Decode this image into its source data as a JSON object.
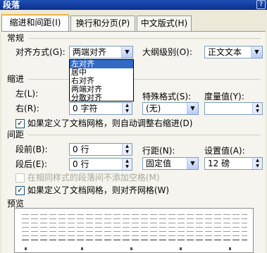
{
  "window": {
    "title": "段落",
    "help": "?"
  },
  "tabs": [
    {
      "label": "缩进和间距",
      "key": "(I)",
      "active": true
    },
    {
      "label": "换行和分页",
      "key": "(P)",
      "active": false
    },
    {
      "label": "中文版式",
      "key": "(H)",
      "active": false
    }
  ],
  "general": {
    "section_title": "常规",
    "alignment_label": "对齐方式",
    "alignment_key": "(G):",
    "alignment_value": "两端对齐",
    "alignment_options": [
      "左对齐",
      "居中",
      "右对齐",
      "两端对齐",
      "分散对齐"
    ],
    "alignment_highlighted": "左对齐",
    "outline_label": "大纲级别",
    "outline_key": "(O):",
    "outline_value": "正文文本"
  },
  "indent": {
    "section_title": "缩进",
    "left_label": "左",
    "left_key": "(L):",
    "right_label": "右",
    "right_key": "(R):",
    "right_value": "0 字符",
    "special_label": "特殊格式",
    "special_key": "(S):",
    "special_value": "(无)",
    "by_label": "度量值",
    "by_key": "(Y):",
    "by_value": "",
    "auto_adjust_label": "如果定义了文档网格，则自动调整右缩进",
    "auto_adjust_key": "(D)",
    "auto_adjust_checked": true
  },
  "spacing": {
    "section_title": "间距",
    "before_label": "段前",
    "before_key": "(B):",
    "before_value": "0 行",
    "after_label": "段后",
    "after_key": "(E):",
    "after_value": "0 行",
    "line_label": "行距",
    "line_key": "(N):",
    "line_value": "固定值",
    "at_label": "设置值",
    "at_key": "(A):",
    "at_value": "12 磅",
    "no_space_label": "在相同样式的段落间不添加空格",
    "no_space_key": "(M)",
    "no_space_checked": false,
    "snap_grid_label": "如果定义了文档网格，则对齐网格",
    "snap_grid_key": "(W)",
    "snap_grid_checked": true
  },
  "preview": {
    "section_title": "预览"
  },
  "icons": {
    "dropdown": "chevron-down-icon",
    "spin_up": "up-icon",
    "spin_down": "down-icon",
    "check": "checkmark-icon"
  }
}
